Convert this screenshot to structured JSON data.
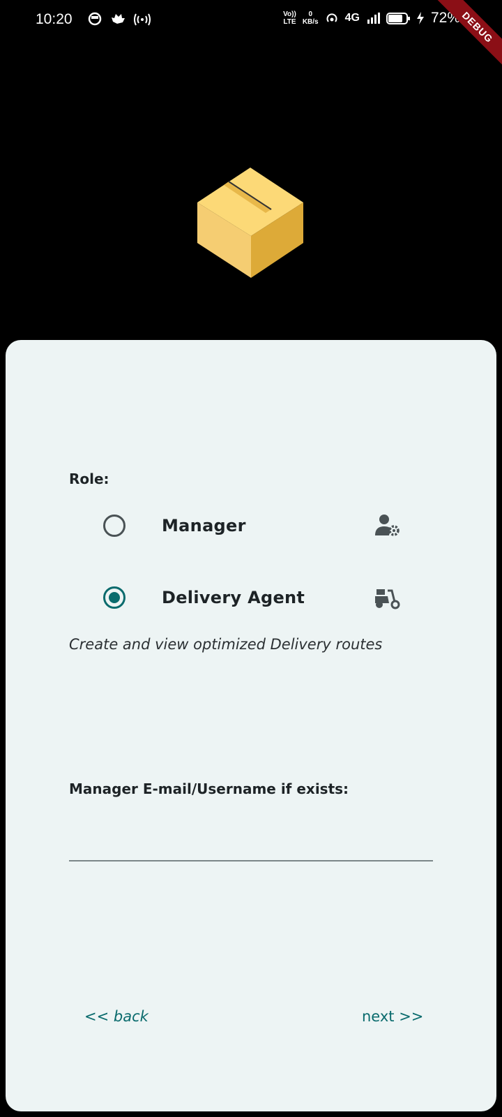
{
  "status_bar": {
    "time": "10:20",
    "volte_top": "Vo))",
    "volte_bottom": "LTE",
    "speed_value": "0",
    "speed_unit": "KB/s",
    "network": "4G",
    "battery": "72%"
  },
  "debug_banner": "DEBUG",
  "form": {
    "role_label": "Role:",
    "options": [
      {
        "label": "Manager",
        "selected": false,
        "icon": "user-gear-icon"
      },
      {
        "label": "Delivery Agent",
        "selected": true,
        "icon": "scooter-icon"
      }
    ],
    "role_description": "Create and view optimized Delivery routes",
    "manager_field_label": "Manager E-mail/Username if exists:",
    "manager_field_value": "",
    "manager_field_placeholder": ""
  },
  "nav": {
    "back_label": "<< back",
    "next_label": "next >>"
  },
  "colors": {
    "accent": "#0a6b6d",
    "card_bg": "#edf4f4",
    "box_light": "#f5cd72",
    "box_dark": "#ddaa38"
  }
}
